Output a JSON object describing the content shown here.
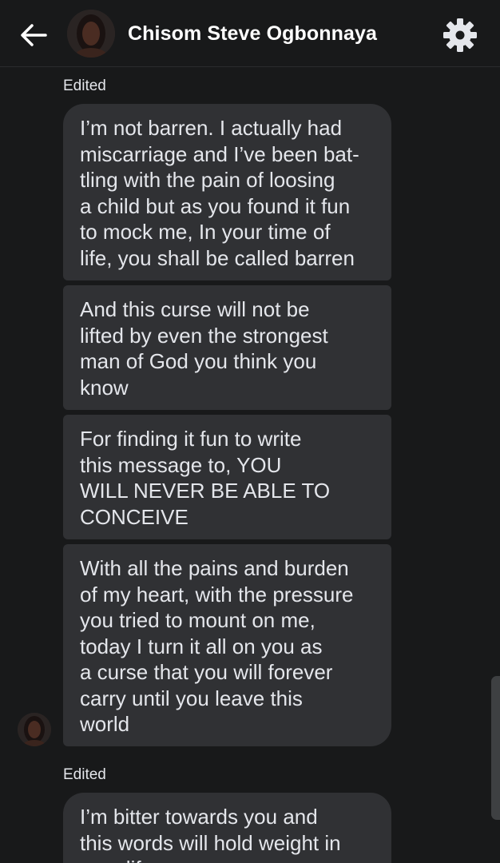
{
  "header": {
    "contact_name": "Chisom Steve Ogbonnaya",
    "back_icon": "arrow-left-icon",
    "settings_icon": "gear-icon"
  },
  "messages": [
    {
      "edited_label": "Edited",
      "text": "I’m not barren. I actually had\nmiscarriage and I’ve been bat-\ntling with the pain of loosing\na child but as you found it fun\nto mock me, In your time of\nlife, you shall be called barren"
    },
    {
      "text": "And this curse will not be\nlifted by even the strongest\nman of God you think you\nknow"
    },
    {
      "text": "For finding it fun to write\nthis message to, YOU\nWILL NEVER BE ABLE TO\nCONCEIVE"
    },
    {
      "text": "With all the pains and burden\nof my heart, with the pressure\nyou tried to mount on me,\ntoday I turn it all on you as\na curse that you will forever\ncarry until you leave this\nworld"
    },
    {
      "edited_label": "Edited",
      "text": "I’m bitter towards you and\nthis words will hold weight in\nyour life"
    }
  ],
  "colors": {
    "background": "#18191a",
    "bubble": "#303134",
    "text": "#e4e6eb"
  }
}
